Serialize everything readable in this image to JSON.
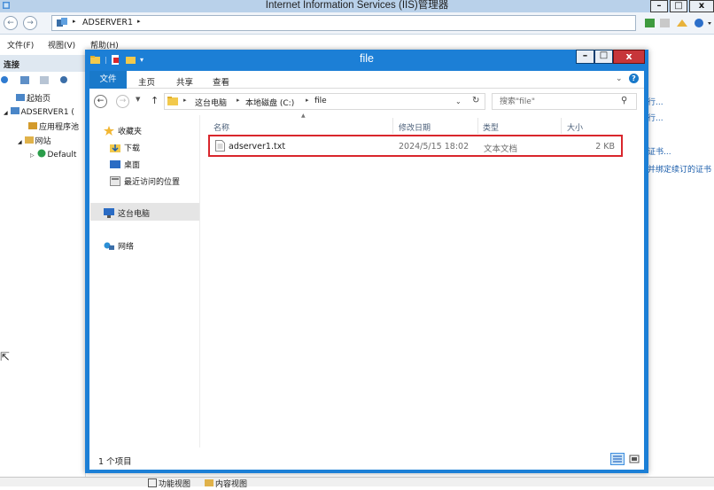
{
  "iis": {
    "title": "Internet Information Services (IIS)管理器",
    "address_server": "ADSERVER1",
    "menu": [
      "文件(F)",
      "视图(V)",
      "帮助(H)"
    ],
    "connections_header": "连接",
    "tree": {
      "start_page": "起始页",
      "server": "ADSERVER1 (",
      "app_pools": "应用程序池",
      "sites": "网站",
      "default_site": "Default"
    },
    "right_links": [
      "行...",
      "行...",
      "证书...",
      "并绑定续订的证书"
    ],
    "bottom_tabs": [
      "功能视图",
      "内容视图"
    ]
  },
  "explorer": {
    "title": "file",
    "ribbon_tabs": [
      "文件",
      "主页",
      "共享",
      "查看"
    ],
    "breadcrumb": [
      "这台电脑",
      "本地磁盘 (C:)",
      "file"
    ],
    "search_placeholder": "搜索\"file\"",
    "nav": {
      "favorites": "收藏夹",
      "downloads": "下载",
      "desktop": "桌面",
      "recent": "最近访问的位置",
      "this_pc": "这台电脑",
      "network": "网络"
    },
    "columns": [
      "名称",
      "修改日期",
      "类型",
      "大小"
    ],
    "files": [
      {
        "name": "adserver1.txt",
        "modified": "2024/5/15 18:02",
        "type": "文本文档",
        "size": "2 KB"
      }
    ],
    "status": "1 个项目"
  },
  "colors": {
    "accent": "#1979ca",
    "window_frame": "#1c7fd6",
    "highlight_border": "#d9262c",
    "close_button": "#c7363a"
  }
}
